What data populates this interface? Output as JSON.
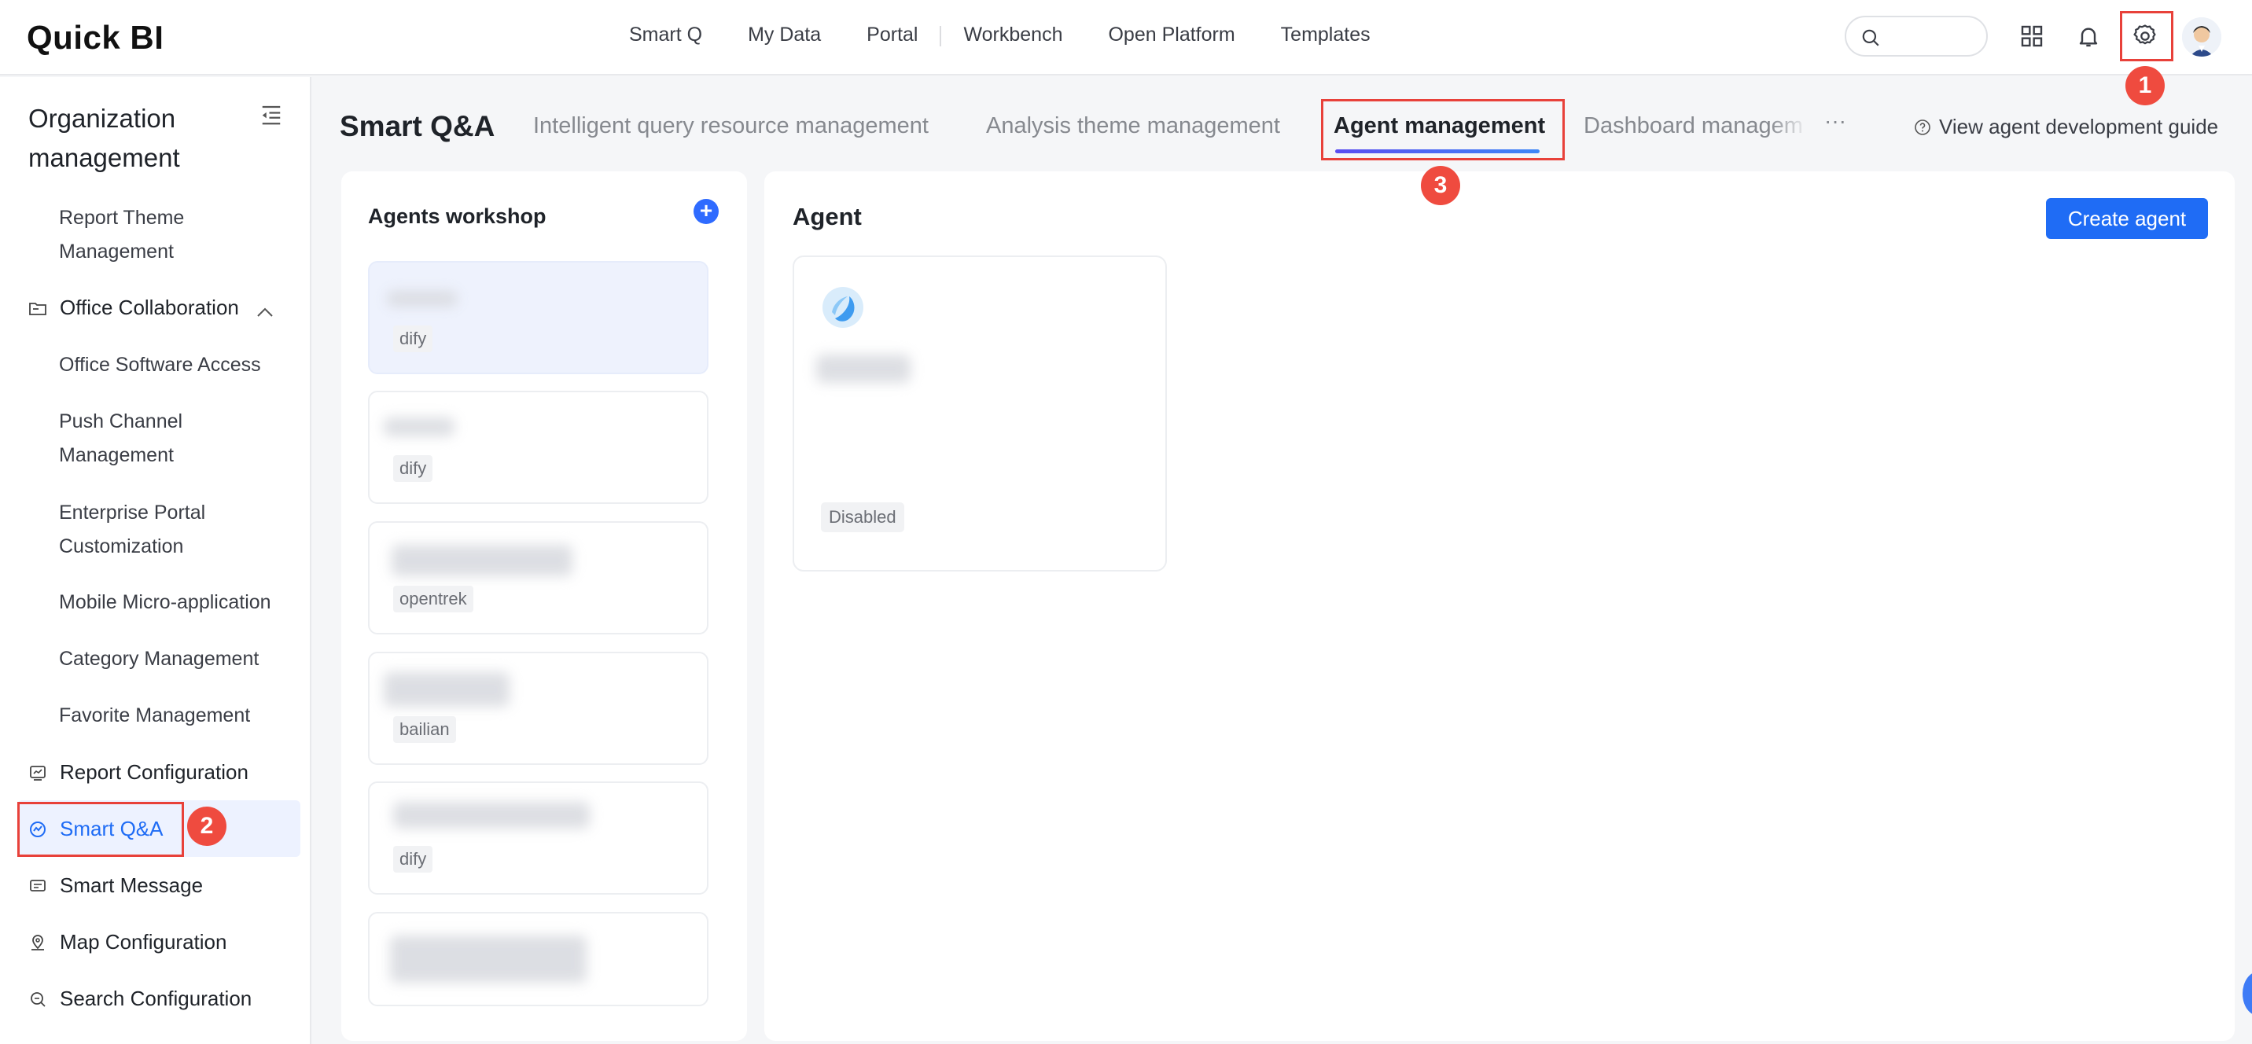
{
  "app": {
    "logo": "Quick BI"
  },
  "topnav": {
    "items": [
      "Smart Q",
      "My Data",
      "Portal",
      "Workbench",
      "Open Platform",
      "Templates"
    ]
  },
  "top_icons": [
    "search-icon",
    "apps-grid-icon",
    "bell-icon",
    "gear-icon",
    "avatar"
  ],
  "sidebar": {
    "title": "Organization management",
    "items": [
      {
        "label": "Report Theme Management"
      },
      {
        "label": "Office Collaboration",
        "group": true,
        "expanded": true
      },
      {
        "label": "Office Software Access"
      },
      {
        "label": "Push Channel Management"
      },
      {
        "label": "Enterprise Portal Customization"
      },
      {
        "label": "Mobile Micro-application"
      },
      {
        "label": "Category Management"
      },
      {
        "label": "Favorite Management"
      },
      {
        "label": "Report Configuration",
        "group": true
      },
      {
        "label": "Smart Q&A",
        "group": true,
        "active": true
      },
      {
        "label": "Smart Message",
        "group": true
      },
      {
        "label": "Map Configuration",
        "group": true
      },
      {
        "label": "Search Configuration",
        "group": true
      }
    ]
  },
  "header": {
    "title": "Smart Q&A",
    "tabs": [
      {
        "label": "Intelligent query resource management"
      },
      {
        "label": "Analysis theme management"
      },
      {
        "label": "Agent management",
        "active": true
      },
      {
        "label": "Dashboard managem"
      }
    ],
    "more": "···",
    "guide": "View agent development guide"
  },
  "workshop": {
    "title": "Agents workshop",
    "cards": [
      {
        "tag": "dify",
        "selected": true
      },
      {
        "tag": "dify"
      },
      {
        "tag": "opentrek"
      },
      {
        "tag": "bailian"
      },
      {
        "tag": "dify"
      },
      {
        "tag": ""
      }
    ]
  },
  "agent": {
    "title": "Agent",
    "create_label": "Create agent",
    "card_status": "Disabled"
  },
  "annotations": [
    "1",
    "2",
    "3"
  ],
  "colors": {
    "accent": "#1f6cf5",
    "annotation": "#e8413a",
    "active_bg": "#edf2ff"
  }
}
